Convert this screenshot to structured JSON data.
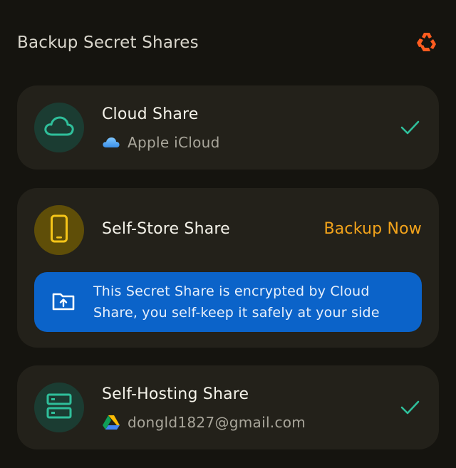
{
  "header": {
    "title": "Backup Secret Shares",
    "logo_icon": "recycle-logo-icon",
    "accent": "#ff5c1f"
  },
  "cards": {
    "cloud": {
      "title": "Cloud Share",
      "provider": "Apple iCloud",
      "icon": "cloud-icon",
      "provider_icon": "icloud-icon",
      "status": "check-icon"
    },
    "self_store": {
      "title": "Self-Store Share",
      "action": "Backup Now",
      "icon": "phone-icon",
      "banner": {
        "text": "This Secret Share is encrypted by Cloud Share, you self-keep it safely at your side",
        "icon": "folder-upload-icon"
      }
    },
    "self_hosting": {
      "title": "Self-Hosting Share",
      "account": "dongld1827@gmail.com",
      "icon": "server-icon",
      "provider_icon": "google-drive-icon",
      "status": "check-icon"
    }
  },
  "colors": {
    "background": "#15140f",
    "card": "#23211a",
    "teal": "#2fbf9b",
    "yellow": "#f5c518",
    "orange": "#f2a31b",
    "blue": "#0b63c9"
  }
}
